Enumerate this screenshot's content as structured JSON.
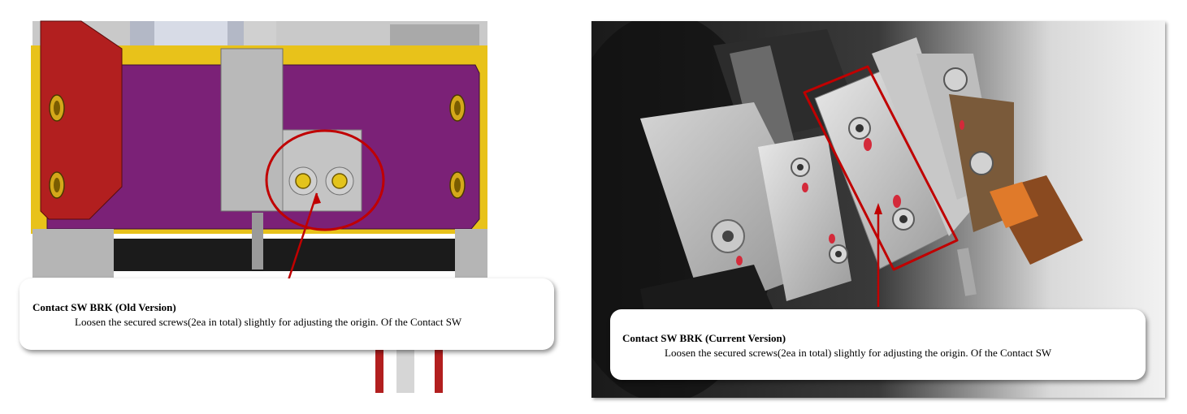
{
  "old_version": {
    "title": "Contact SW BRK (Old Version)",
    "description": "Loosen the secured screws(2ea in total) slightly for adjusting the origin. Of the Contact SW"
  },
  "current_version": {
    "title": "Contact SW BRK (Current Version)",
    "description": "Loosen the secured screws(2ea in total) slightly for adjusting the origin. Of the Contact SW"
  },
  "colors": {
    "highlight_red": "#c00000",
    "bracket_purple": "#7b2177",
    "frame_yellow": "#e8c21a"
  }
}
